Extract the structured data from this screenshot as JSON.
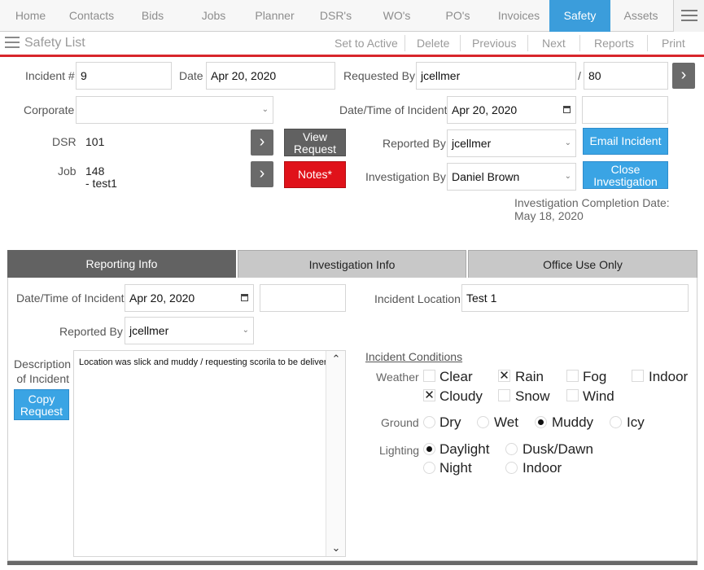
{
  "nav": {
    "items": [
      {
        "label": "Home"
      },
      {
        "label": "Contacts"
      },
      {
        "label": "Bids"
      },
      {
        "label": "Jobs"
      },
      {
        "label": "Planner"
      },
      {
        "label": "DSR's"
      },
      {
        "label": "WO's"
      },
      {
        "label": "PO's"
      },
      {
        "label": "Invoices"
      },
      {
        "label": "Safety"
      },
      {
        "label": "Assets"
      }
    ],
    "active": "Safety"
  },
  "subbar": {
    "title": "Safety List",
    "actions": {
      "set_active": "Set to Active",
      "delete": "Delete",
      "previous": "Previous",
      "next": "Next",
      "reports": "Reports",
      "print": "Print"
    }
  },
  "header": {
    "incident_label": "Incident #",
    "incident_value": "9",
    "date_label": "Date",
    "date_value": "Apr 20, 2020",
    "requested_by_label": "Requested By",
    "requested_by_value": "jcellmer",
    "slash": "/",
    "requested_by_num": "80",
    "corporate_label": "Corporate",
    "corporate_value": "",
    "incident_dt_label": "Date/Time of Incident",
    "incident_dt_value": "Apr 20, 2020",
    "incident_time_value": "",
    "dsr_label": "DSR",
    "dsr_value": "101",
    "job_label": "Job",
    "job_value_line1": "148",
    "job_value_line2": "- test1",
    "view_request_line1": "View",
    "view_request_line2": "Request",
    "notes_label": "Notes*",
    "reported_by_label": "Reported By",
    "reported_by_value": "jcellmer",
    "email_incident_label": "Email Incident",
    "investigation_by_label": "Investigation By",
    "investigation_by_value": "Daniel Brown",
    "close_investigation_line1": "Close",
    "close_investigation_line2": "Investigation",
    "inv_completion_label": "Investigation Completion Date:",
    "inv_completion_value": "May 18, 2020"
  },
  "tabs": [
    {
      "label": "Reporting Info"
    },
    {
      "label": "Investigation Info"
    },
    {
      "label": "Office Use Only"
    }
  ],
  "reporting": {
    "dt_label": "Date/Time of Incident",
    "dt_value": "Apr 20, 2020",
    "time_value": "",
    "location_label": "Incident Location",
    "location_value": "Test 1",
    "reported_by_label": "Reported By",
    "reported_by_value": "jcellmer",
    "desc_label_line1": "Description",
    "desc_label_line2": "of Incident",
    "desc_value": "Location was slick and muddy / requesting scorila to be delivered",
    "copy_request_line1": "Copy",
    "copy_request_line2": "Request"
  },
  "conditions": {
    "title": "Incident Conditions",
    "weather_label": "Weather",
    "weather": [
      {
        "label": "Clear",
        "checked": false
      },
      {
        "label": "Rain",
        "checked": true,
        "mark": "✕"
      },
      {
        "label": "Fog",
        "checked": false
      },
      {
        "label": "Indoor",
        "checked": false
      },
      {
        "label": "Cloudy",
        "checked": true,
        "mark": "✕"
      },
      {
        "label": "Snow",
        "checked": false
      },
      {
        "label": "Wind",
        "checked": false
      }
    ],
    "ground_label": "Ground",
    "ground": [
      {
        "label": "Dry",
        "selected": false
      },
      {
        "label": "Wet",
        "selected": false
      },
      {
        "label": "Muddy",
        "selected": true
      },
      {
        "label": "Icy",
        "selected": false
      }
    ],
    "lighting_label": "Lighting",
    "lighting": [
      {
        "label": "Daylight",
        "selected": true
      },
      {
        "label": "Dusk/Dawn",
        "selected": false
      },
      {
        "label": "Night",
        "selected": false
      },
      {
        "label": "Indoor",
        "selected": false
      }
    ]
  }
}
